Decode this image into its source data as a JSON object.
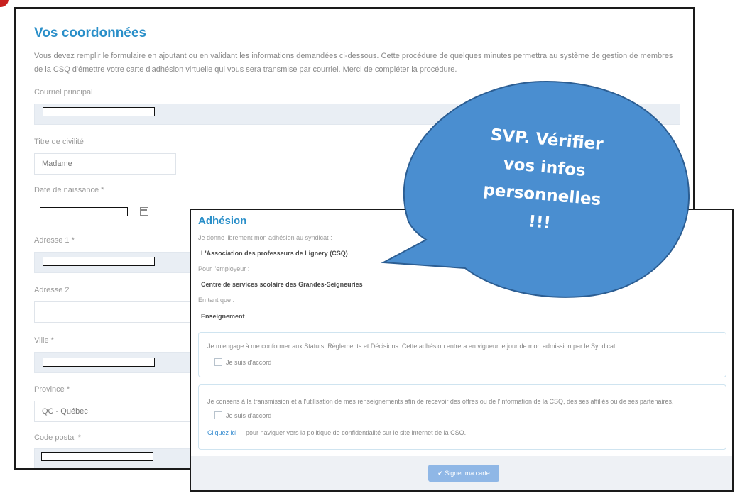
{
  "coordonnees": {
    "title": "Vos coordonnées",
    "intro": "Vous devez remplir le formulaire en ajoutant ou en validant les informations demandées ci-dessous. Cette procédure de quelques minutes permettra au système de gestion de membres de la CSQ d'émettre votre carte d'adhésion virtuelle qui vous sera transmise par courriel. Merci de compléter la procédure.",
    "courriel_label": "Courriel principal",
    "titre_label": "Titre de civilité",
    "titre_value": "Madame",
    "naissance_label": "Date de naissance *",
    "adresse1_label": "Adresse 1 *",
    "adresse2_label": "Adresse 2",
    "ville_label": "Ville *",
    "province_label": "Province *",
    "province_value": "QC - Québec",
    "postal_label": "Code postal *"
  },
  "adhesion": {
    "title": "Adhésion",
    "syndicat_label": "Je donne librement mon adhésion au syndicat :",
    "syndicat_value": "L'Association des professeurs de Lignery (CSQ)",
    "employeur_label": "Pour l'employeur :",
    "employeur_value": "Centre de services scolaire des Grandes-Seigneuries",
    "titre_label": "En tant que :",
    "titre_value": "Enseignement",
    "consent1_text": "Je m'engage à me conformer aux Statuts, Règlements et Décisions. Cette adhésion entrera en vigueur le jour de mon admission par le Syndicat.",
    "consent1_check": "Je suis d'accord",
    "consent2_text": "Je consens à la transmission et à l'utilisation de mes renseignements afin de recevoir des offres ou de l'information de la CSQ, des ses affiliés ou de ses partenaires.",
    "consent2_check": "Je suis d'accord",
    "link_label": "Cliquez ici",
    "link_rest": "pour naviguer vers la politique de confidentialité sur le site internet de la CSQ.",
    "submit_label": "✔ Signer ma carte"
  },
  "bubble": {
    "line1": "SVP. Vérifier",
    "line2": "vos infos",
    "line3": "personnelles",
    "line4": "!!!",
    "fill": "#4a8ed0",
    "stroke": "#2c5e93"
  }
}
